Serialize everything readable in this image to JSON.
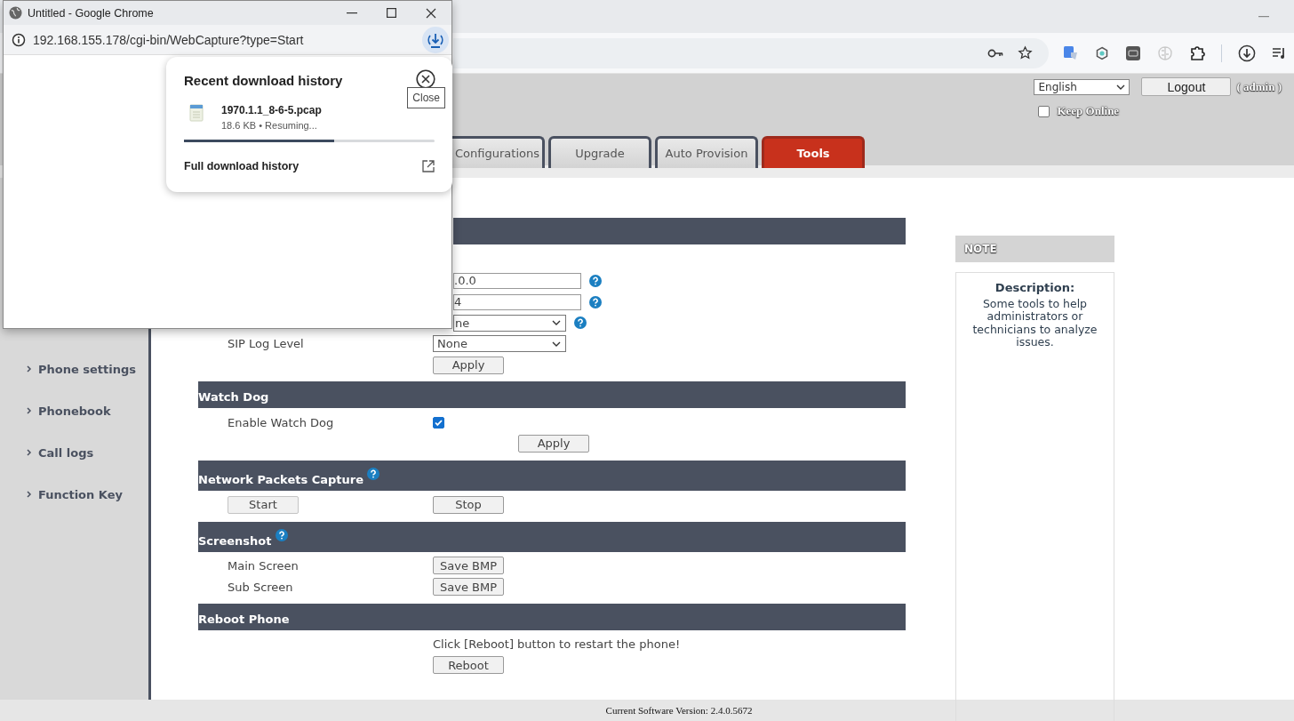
{
  "header": {
    "language": "English",
    "logout": "Logout",
    "user": "( admin )",
    "keep_online": {
      "label": "Keep Online",
      "checked": false
    }
  },
  "tabs": [
    {
      "label": "Configurations",
      "selected": false
    },
    {
      "label": "Upgrade",
      "selected": false
    },
    {
      "label": "Auto Provision",
      "selected": false
    },
    {
      "label": "Tools",
      "selected": true
    }
  ],
  "sidebar": {
    "items": [
      "Phone settings",
      "Phonebook",
      "Call logs",
      "Function Key"
    ]
  },
  "sections": [
    {
      "rows": [
        {
          "kind": "input",
          "value": ".0.0",
          "help": true
        },
        {
          "kind": "input",
          "value": "4",
          "help": true
        },
        {
          "kind": "select",
          "value": "ne",
          "help": true
        },
        {
          "kind": "select",
          "label": "SIP Log Level",
          "value": "None"
        },
        {
          "kind": "button",
          "button": "Apply"
        }
      ]
    },
    {
      "title": "Watch Dog",
      "rows": [
        {
          "kind": "checkbox",
          "label": "Enable Watch Dog",
          "checked": true
        },
        {
          "kind": "button",
          "button": "Apply",
          "offset": true
        }
      ]
    },
    {
      "title": "Network Packets Capture",
      "help": true,
      "rows": [
        {
          "kind": "buttons",
          "buttons": [
            "Start",
            "Stop"
          ]
        }
      ]
    },
    {
      "title": "Screenshot",
      "help": true,
      "rows": [
        {
          "kind": "button",
          "label": "Main Screen",
          "button": "Save BMP"
        },
        {
          "kind": "button",
          "label": "Sub Screen",
          "button": "Save BMP"
        }
      ]
    },
    {
      "title": "Reboot Phone",
      "rows": [
        {
          "kind": "text",
          "text": "Click [Reboot] button to restart the phone!"
        },
        {
          "kind": "button",
          "button": "Reboot"
        }
      ]
    }
  ],
  "note": {
    "title": "NOTE",
    "heading": "Description:",
    "text": "Some tools to help administrators or technicians to analyze issues."
  },
  "footer": "Current Software Version: 2.4.0.5672",
  "popup": {
    "title": "Untitled - Google Chrome",
    "url": "192.168.155.178/cgi-bin/WebCapture?type=Start",
    "downloads": {
      "title": "Recent download history",
      "tooltip": "Close",
      "file": {
        "name": "1970.1.1_8-6-5.pcap",
        "status": "18.6 KB • Resuming...",
        "level": 0.6
      },
      "footer": "Full download history"
    }
  }
}
